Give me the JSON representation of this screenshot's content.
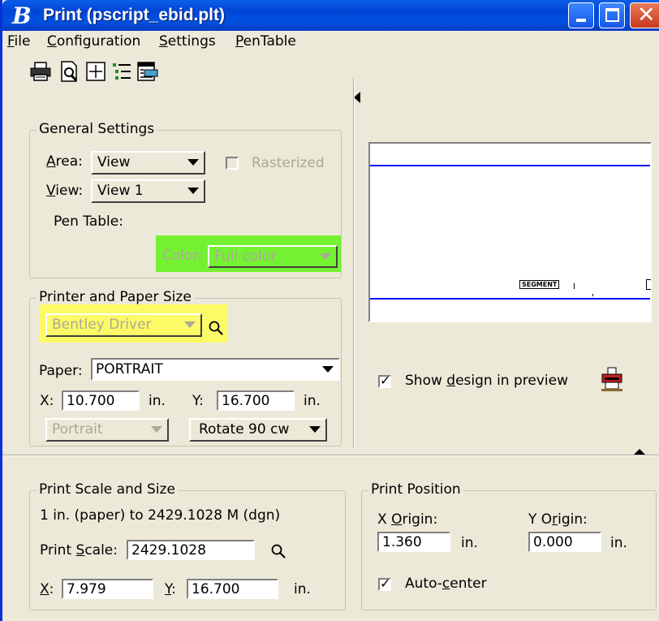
{
  "window": {
    "title": "Print  (pscript_ebid.plt)",
    "app_icon_glyph": "B"
  },
  "menu": [
    "File",
    "Configuration",
    "Settings",
    "PenTable"
  ],
  "toolbar_icons": [
    "printer-icon",
    "print-preview-icon",
    "fit-area-icon",
    "list-icon",
    "driver-config-icon"
  ],
  "general_settings": {
    "title": "General Settings",
    "area_label": "Area:",
    "area_value": "View",
    "rasterized_label": "Rasterized",
    "view_label": "View:",
    "view_value": "View 1",
    "pen_table_label": "Pen Table:",
    "color_label": "Color:",
    "color_value": "Full color"
  },
  "printer_paper": {
    "title": "Printer and Paper Size",
    "driver_value": "Bentley Driver",
    "paper_label": "Paper:",
    "paper_value": "PORTRAIT",
    "x_label": "X:",
    "x_value": "10.700",
    "x_unit": "in.",
    "y_label": "Y:",
    "y_value": "16.700",
    "y_unit": "in.",
    "orientation_value": "Portrait",
    "rotation_value": "Rotate 90 cw"
  },
  "preview": {
    "segment_label": "SEGMENT",
    "show_design_label": "Show design in preview",
    "show_design_checked": true
  },
  "print_scale": {
    "title": "Print Scale and Size",
    "scale_text": "1 in. (paper) to 2429.1028 M (dgn)",
    "scale_label": "Print Scale:",
    "scale_value": "2429.1028",
    "x_label": "X:",
    "x_value": "7.979",
    "y_label": "Y:",
    "y_value": "16.700",
    "unit": "in."
  },
  "print_position": {
    "title": "Print Position",
    "x_origin_label": "X Origin:",
    "x_origin_value": "1.360",
    "x_unit": "in.",
    "y_origin_label": "Y Origin:",
    "y_origin_value": "0.000",
    "y_unit": "in.",
    "auto_center_label": "Auto-center",
    "auto_center_checked": true
  },
  "colors": {
    "title_bar": "#0052e0",
    "highlight_green": "#74f231",
    "highlight_yellow": "#fcfa66",
    "preview_line": "#0a0aff"
  }
}
